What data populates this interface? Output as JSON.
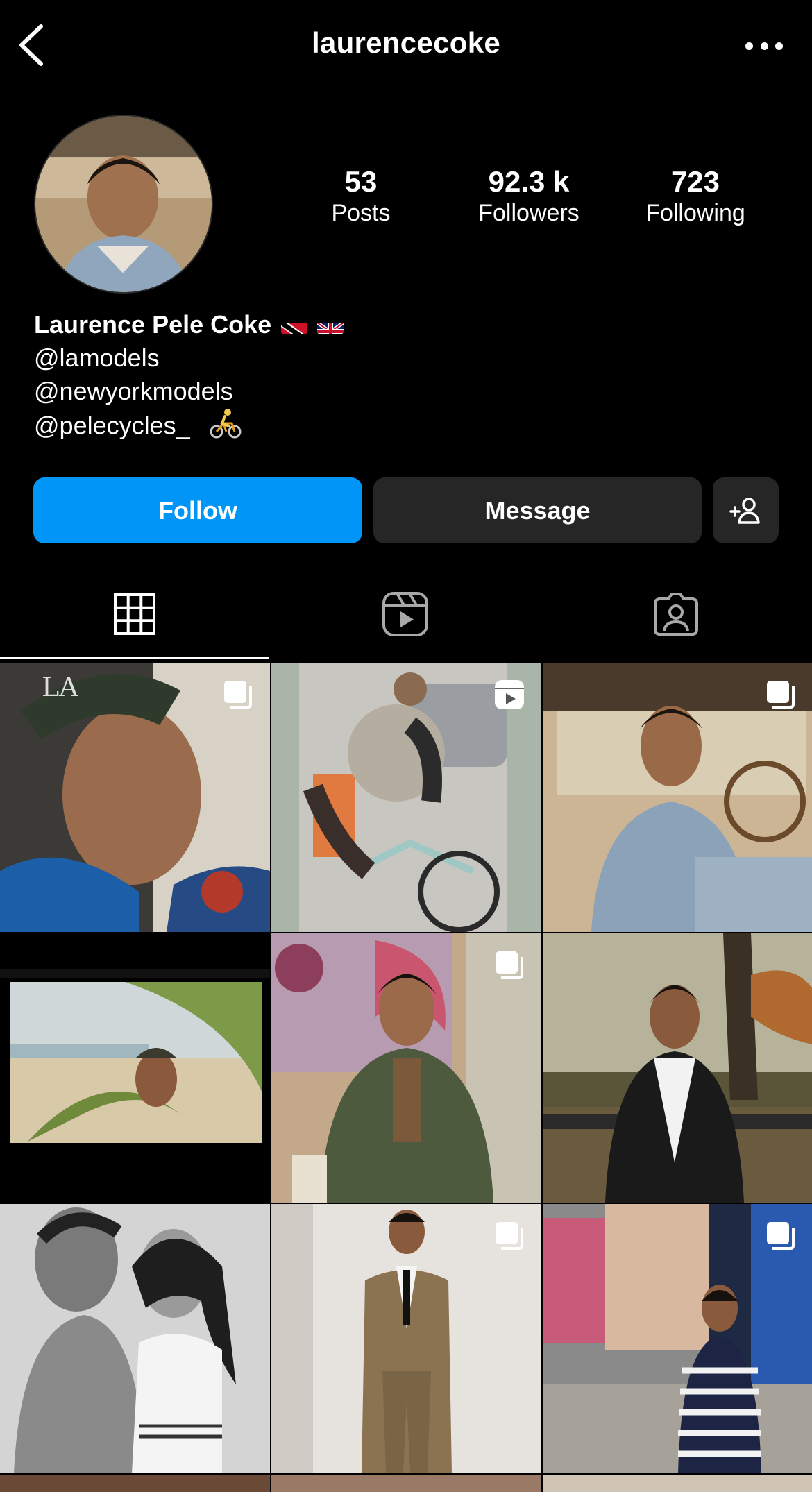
{
  "header": {
    "username": "laurencecoke",
    "back_icon": "chevron-left-icon",
    "more_icon": "ellipsis-icon"
  },
  "profile": {
    "stats": [
      {
        "value": "53",
        "label": "Posts"
      },
      {
        "value": "92.3 k",
        "label": "Followers"
      },
      {
        "value": "723",
        "label": "Following"
      }
    ],
    "display_name": "Laurence Pele Coke",
    "flags": [
      "trinidad-and-tobago-flag",
      "united-kingdom-flag"
    ],
    "bio_lines": [
      "@lamodels",
      "@newyorkmodels",
      "@pelecycles_"
    ],
    "bio_emoji": "cyclist-icon"
  },
  "actions": {
    "follow_label": "Follow",
    "message_label": "Message",
    "suggest_icon": "add-person-icon"
  },
  "tabs": [
    {
      "name": "posts",
      "icon": "grid-icon",
      "active": true
    },
    {
      "name": "reels",
      "icon": "reels-icon",
      "active": false
    },
    {
      "name": "tagged",
      "icon": "tagged-person-icon",
      "active": false
    }
  ],
  "grid": [
    {
      "subject": "man-in-la-cap",
      "badge": "carousel-icon"
    },
    {
      "subject": "cyclist-on-bike",
      "badge": "reels-icon"
    },
    {
      "subject": "man-in-car-denim",
      "badge": "carousel-icon"
    },
    {
      "subject": "beach-film-frame",
      "badge": ""
    },
    {
      "subject": "man-graffiti-wall",
      "badge": "carousel-icon"
    },
    {
      "subject": "man-on-park-bench",
      "badge": ""
    },
    {
      "subject": "couple-black-white",
      "badge": ""
    },
    {
      "subject": "man-in-brown-suit",
      "badge": "carousel-icon"
    },
    {
      "subject": "man-times-square",
      "badge": "carousel-icon"
    }
  ],
  "colors": {
    "background": "#000000",
    "follow_button": "#0095f6",
    "secondary_button": "#262626",
    "text": "#ffffff"
  }
}
